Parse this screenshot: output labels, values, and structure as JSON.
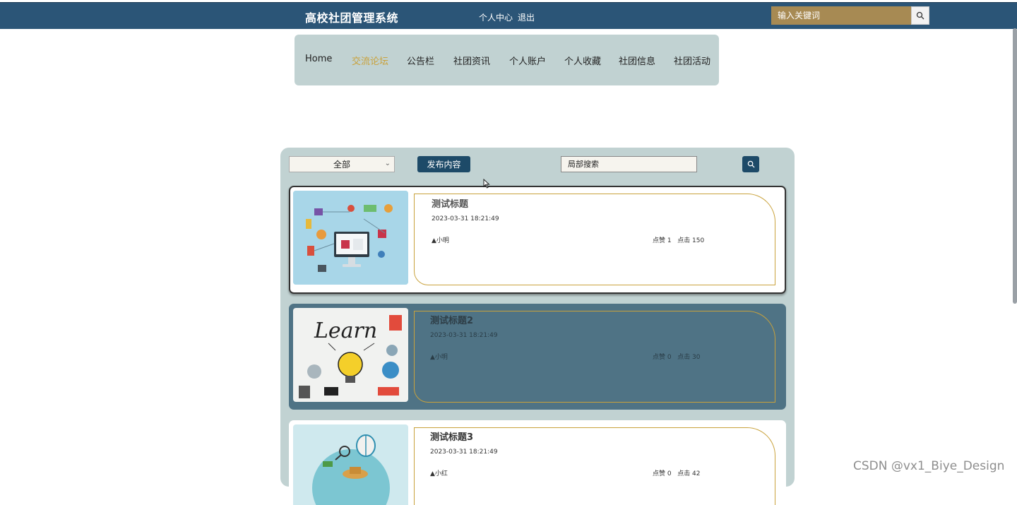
{
  "header": {
    "site_title": "高校社团管理系统",
    "links": [
      "个人中心",
      "退出"
    ],
    "search_placeholder": "输入关键词"
  },
  "nav": {
    "items": [
      {
        "label": "Home"
      },
      {
        "label": "交流论坛"
      },
      {
        "label": "公告栏"
      },
      {
        "label": "社团资讯"
      },
      {
        "label": "个人账户"
      },
      {
        "label": "个人收藏"
      },
      {
        "label": "社团信息"
      },
      {
        "label": "社团活动"
      }
    ],
    "active": "交流论坛"
  },
  "toolbar": {
    "filter_selected": "全部",
    "publish_label": "发布内容",
    "local_search_value": "局部搜索"
  },
  "posts": [
    {
      "title": "测试标题",
      "date": "2023-03-31 18:21:49",
      "author": "小明",
      "likes_label": "点赞 1",
      "clicks_label": "点击 150",
      "image": "ecommerce-illustration"
    },
    {
      "title": "测试标题2",
      "date": "2023-03-31 18:21:49",
      "author": "小明",
      "likes_label": "点赞 0",
      "clicks_label": "点击 30",
      "image": "learn-lightbulb-illustration"
    },
    {
      "title": "测试标题3",
      "date": "2023-03-31 18:21:49",
      "author": "小红",
      "likes_label": "点赞 0",
      "clicks_label": "点击 42",
      "image": "travel-illustration"
    }
  ],
  "watermark": "CSDN @vx1_Biye_Design",
  "colors": {
    "topbar": "#2b5577",
    "accent_gold": "#c9a23c",
    "panel": "#c1d2d2",
    "button_dark": "#1d4a68",
    "hover_card": "#4f7385"
  }
}
